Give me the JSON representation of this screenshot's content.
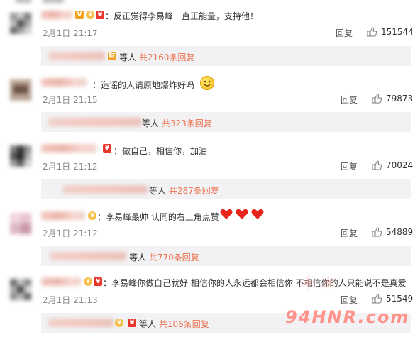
{
  "comments": [
    {
      "text": "：反正觉得李易峰一直正能量，支持他！",
      "time": "2月1日 21:17",
      "reply_label": "回复",
      "likes": "151544",
      "sub": {
        "prefix": "等人",
        "count_text": "共2160条回复"
      }
    },
    {
      "text": "：造谣的人请原地爆炸好吗",
      "time": "2月1日 21:15",
      "reply_label": "回复",
      "likes": "79873",
      "sub": {
        "prefix": "等人",
        "count_text": "共323条回复"
      }
    },
    {
      "text": "：做自己，相信你，加油",
      "time": "2月1日 21:12",
      "reply_label": "回复",
      "likes": "70024",
      "sub": {
        "prefix": "等人",
        "count_text": "共287条回复"
      }
    },
    {
      "text": "：李易峰最帅 认同的右上角点赞",
      "time": "2月1日 21:12",
      "reply_label": "回复",
      "likes": "54889",
      "sub": {
        "prefix": "等人",
        "count_text": "共770条回复"
      }
    },
    {
      "text": "：李易峰你做自己就好 相信你的人永远都会相信你 不相信你的人只能说不是真爱",
      "time": "2月1日 21:13",
      "reply_label": "回复",
      "likes": "51549",
      "sub": {
        "prefix": "等人",
        "count_text": "共106条回复"
      }
    }
  ],
  "watermark": "94HNR.com",
  "colors": {
    "link": "#eb7350",
    "subbox_bg": "#f2f2f5",
    "muted": "#888888"
  },
  "icons": [
    "thumb-up-icon",
    "vip-badge-icon",
    "red-packet-icon",
    "smile-emoji-icon",
    "heart-emoji-icon",
    "crown-badge-icon"
  ]
}
